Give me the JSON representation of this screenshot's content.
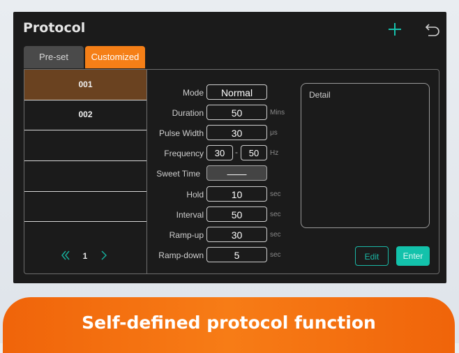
{
  "header": {
    "title": "Protocol",
    "plus_icon": "plus-icon",
    "back_icon": "back-arrow-icon"
  },
  "tabs": [
    {
      "label": "Pre-set",
      "active": false
    },
    {
      "label": "Customized",
      "active": true
    }
  ],
  "protocol_list": {
    "items": [
      "001",
      "002",
      "",
      "",
      ""
    ],
    "selected": "001"
  },
  "pager": {
    "page": "1"
  },
  "settings": {
    "mode": {
      "label": "Mode",
      "value": "Normal"
    },
    "duration": {
      "label": "Duration",
      "value": "50",
      "unit": "Mins"
    },
    "pulse_width": {
      "label": "Pulse Width",
      "value": "30",
      "unit": "μs"
    },
    "frequency": {
      "label": "Frequency",
      "min": "30",
      "max": "50",
      "separator": "-",
      "unit": "Hz"
    },
    "sweet_time": {
      "label": "Sweet Time",
      "value": "——"
    },
    "hold": {
      "label": "Hold",
      "value": "10",
      "unit": "sec"
    },
    "interval": {
      "label": "Interval",
      "value": "50",
      "unit": "sec"
    },
    "ramp_up": {
      "label": "Ramp-up",
      "value": "30",
      "unit": "sec"
    },
    "ramp_down": {
      "label": "Ramp-down",
      "value": "5",
      "unit": "sec"
    }
  },
  "detail": {
    "title": "Detail"
  },
  "buttons": {
    "edit": "Edit",
    "enter": "Enter"
  },
  "banner": {
    "text": "Self-defined protocol function"
  },
  "colors": {
    "accent": "#f57f17",
    "teal": "#13c2ab",
    "selected_row": "#6a4220"
  }
}
